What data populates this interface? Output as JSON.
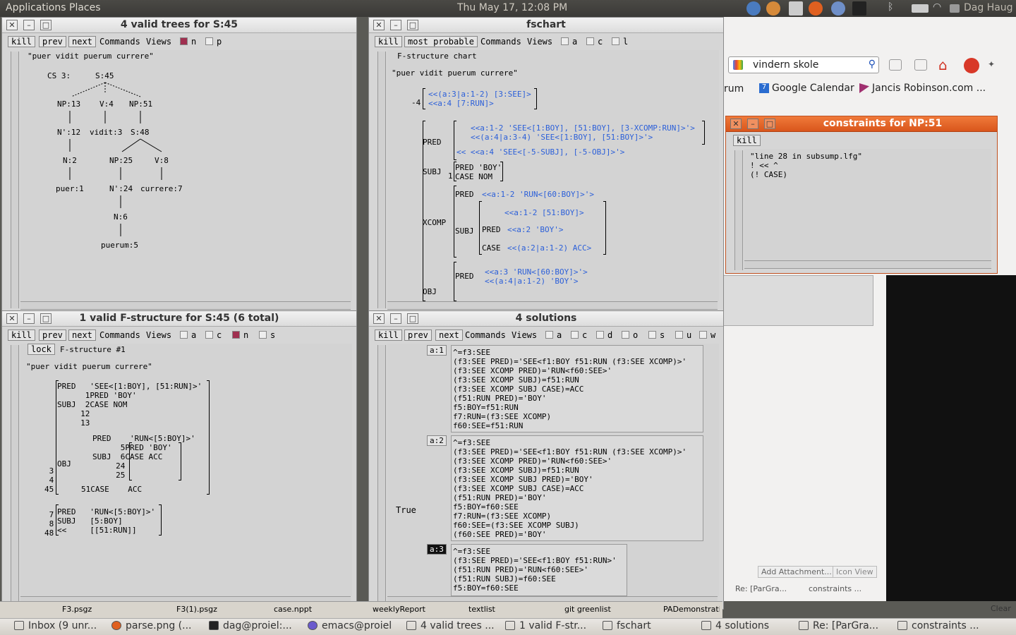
{
  "top_panel": {
    "menus": [
      "Applications",
      "Places"
    ],
    "clock": "Thu May 17, 12:08 PM",
    "user": "Dag Haug"
  },
  "browser": {
    "search_value": "vindern skole",
    "bookmark_1": "Google Calendar",
    "bookmark_2": "Jancis Robinson.com ...",
    "bookmark_prefix": "rum",
    "add_attachment": "Add Attachment...",
    "icon_view": "Icon View",
    "clear": "Clear",
    "tab_re": "Re: [ParGra...",
    "tab_constraints": "constraints ..."
  },
  "trees_window": {
    "title": "4 valid trees for S:45",
    "buttons": [
      "kill",
      "prev",
      "next"
    ],
    "menus": [
      "Commands",
      "Views"
    ],
    "checks": [
      {
        "label": "n",
        "on": true
      },
      {
        "label": "p",
        "on": false
      }
    ],
    "sentence": "\"puer vidit puerum currere\"",
    "nodes": {
      "cs": "CS 3:",
      "s45": "S:45",
      "np13": "NP:13",
      "v4": "V:4",
      "np51": "NP:51",
      "n12": "N':12",
      "vidit3": "vidit:3",
      "s48": "S:48",
      "n2": "N:2",
      "np25": "NP:25",
      "v8": "V:8",
      "puer1": "puer:1",
      "n24": "N':24",
      "currere7": "currere:7",
      "n6": "N:6",
      "puerum5": "puerum:5"
    }
  },
  "fschart_window": {
    "title": "fschart",
    "buttons": [
      "kill",
      "most probable"
    ],
    "menus": [
      "Commands",
      "Views"
    ],
    "checks": [
      {
        "label": "a",
        "on": false
      },
      {
        "label": "c",
        "on": false
      },
      {
        "label": "l",
        "on": false
      }
    ],
    "heading": "F-structure chart",
    "sentence": "\"puer vidit puerum currere\"",
    "top_num": "-4",
    "top_line1": "<<(a:3|a:1-2) [3:SEE]>",
    "top_line2": "<<a:4 [7:RUN]>",
    "pred_label": "PRED",
    "pred_l1": "<<a:1-2 'SEE<[1:BOY], [51:BOY], [3-XCOMP:RUN]>'>",
    "pred_l2": "<<(a:4|a:3-4) 'SEE<[1:BOY], [51:BOY]>'>",
    "pred_l3": "<< <<a:4 'SEE<[-5-SUBJ], [-5-OBJ]>'>",
    "subj_label": "SUBJ",
    "subj_num": "1",
    "subj_pred": "PRED 'BOY'",
    "subj_case": "CASE NOM",
    "xcomp_label": "XCOMP",
    "xcomp_pred_label": "PRED",
    "xcomp_pred": "<<a:1-2 'RUN<[60:BOY]>'>",
    "xcomp_subj_label": "SUBJ",
    "xcomp_subj_eq": "<<a:1-2 [51:BOY]>",
    "xcomp_subj_pred_label": "PRED",
    "xcomp_subj_pred": "<<a:2 'BOY'>",
    "xcomp_case_label": "CASE",
    "xcomp_case": "<<(a:2|a:1-2) ACC>",
    "obj_label": "OBJ",
    "obj_pred_label": "PRED",
    "obj_pred_l1": "<<a:3 'RUN<[60:BOY]>'>",
    "obj_pred_l2": "<<(a:4|a:1-2) 'BOY'>"
  },
  "fstruct_window": {
    "title": "1 valid F-structure for S:45 (6 total)",
    "buttons": [
      "kill",
      "prev",
      "next"
    ],
    "menus": [
      "Commands",
      "Views"
    ],
    "checks": [
      {
        "label": "a",
        "on": false
      },
      {
        "label": "c",
        "on": false
      },
      {
        "label": "n",
        "on": true
      },
      {
        "label": "s",
        "on": false
      }
    ],
    "lock": "lock",
    "heading": "F-structure #1",
    "sentence": "\"puer vidit puerum currere\"",
    "block1": "PRED   'SEE<[1:BOY], [51:RUN]>'\n      1PRED 'BOY'\nSUBJ  2CASE NOM\n     12\n     13",
    "block2": "PRED    'RUN<[5:BOY]>'\n      5PRED 'BOY'\nSUBJ  6CASE ACC\n     24\n     25",
    "obj_label": "OBJ",
    "nums_left": "3\n4\n45",
    "case51": "51CASE    ACC",
    "block3": "PRED   'RUN<[5:BOY]>'\nSUBJ   [5:BOY]\n<<     [[51:RUN]]",
    "nums_block3": "7\n8\n48"
  },
  "solutions_window": {
    "title": "4 solutions",
    "buttons": [
      "kill",
      "prev",
      "next"
    ],
    "menus": [
      "Commands",
      "Views"
    ],
    "checks": [
      {
        "label": "a",
        "on": false
      },
      {
        "label": "c",
        "on": false
      },
      {
        "label": "d",
        "on": false
      },
      {
        "label": "o",
        "on": false
      },
      {
        "label": "s",
        "on": false
      },
      {
        "label": "u",
        "on": false
      },
      {
        "label": "w",
        "on": false
      }
    ],
    "true_label": "True",
    "solutions": [
      {
        "label": "a:1",
        "text": "^=f3:SEE\n(f3:SEE PRED)='SEE<f1:BOY f51:RUN (f3:SEE XCOMP)>'\n(f3:SEE XCOMP PRED)='RUN<f60:SEE>'\n(f3:SEE XCOMP SUBJ)=f51:RUN\n(f3:SEE XCOMP SUBJ CASE)=ACC\n(f51:RUN PRED)='BOY'\nf5:BOY=f51:RUN\nf7:RUN=(f3:SEE XCOMP)\nf60:SEE=f51:RUN"
      },
      {
        "label": "a:2",
        "text": "^=f3:SEE\n(f3:SEE PRED)='SEE<f1:BOY f51:RUN (f3:SEE XCOMP)>'\n(f3:SEE XCOMP PRED)='RUN<f60:SEE>'\n(f3:SEE XCOMP SUBJ)=f51:RUN\n(f3:SEE XCOMP SUBJ PRED)='BOY'\n(f3:SEE XCOMP SUBJ CASE)=ACC\n(f51:RUN PRED)='BOY'\nf5:BOY=f60:SEE\nf7:RUN=(f3:SEE XCOMP)\nf60:SEE=(f3:SEE XCOMP SUBJ)\n(f60:SEE PRED)='BOY'"
      },
      {
        "label": "a:3",
        "text": "^=f3:SEE\n(f3:SEE PRED)='SEE<f1:BOY f51:RUN>'\n(f51:RUN PRED)='RUN<f60:SEE>'\n(f51:RUN SUBJ)=f60:SEE\nf5:BOY=f60:SEE"
      }
    ]
  },
  "constraints_window": {
    "title": "constraints for NP:51",
    "button": "kill",
    "text": "\"line 28 in subsump.lfg\"\n! << ^\n(! CASE)"
  },
  "taskbar": {
    "items": [
      "Inbox (9 unr...",
      "parse.png (...",
      "dag@proiel:...",
      "emacs@proiel",
      "4 valid trees ...",
      "1 valid F-str...",
      "fschart",
      "4 solutions",
      "Re: [ParGra...",
      "constraints ..."
    ]
  },
  "taskbar2": {
    "items": [
      "F3.psgz",
      "F3(1).psgz",
      "case.nppt",
      "weeklyReport",
      "textlist",
      "git greenlist",
      "PADemonstration..."
    ]
  }
}
